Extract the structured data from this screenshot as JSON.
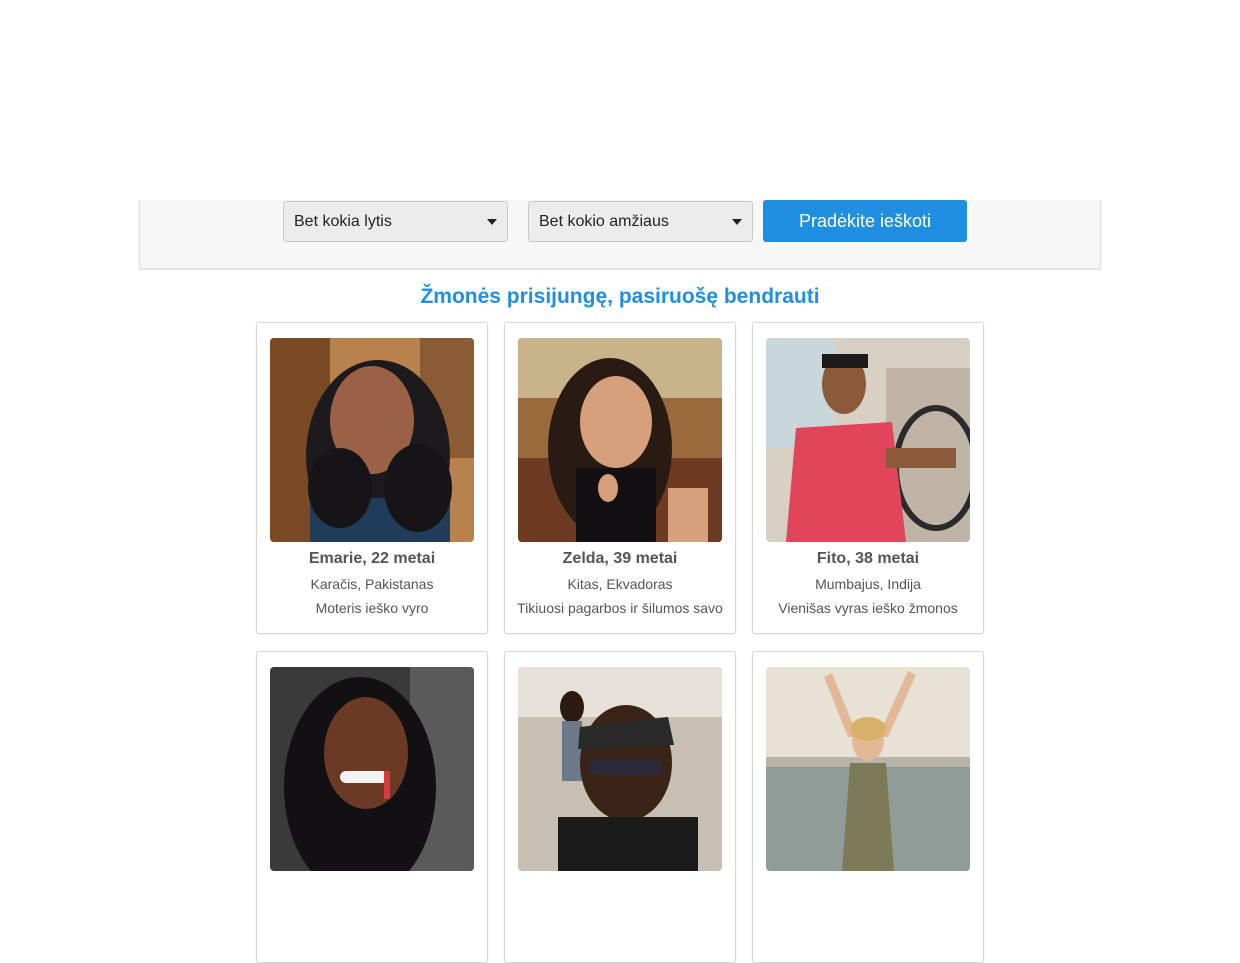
{
  "search": {
    "gender_value": "Bet kokia lytis",
    "age_value": "Bet kokio amžiaus",
    "submit_label": "Pradėkite ieškoti"
  },
  "section": {
    "title": "Žmonės prisijungę, pasiruošę bendrauti"
  },
  "profiles": [
    {
      "name": "Emarie, 22 metai",
      "location": "Karačis, Pakistanas",
      "bio": "Moteris ieško vyro"
    },
    {
      "name": "Zelda, 39 metai",
      "location": "Kitas, Ekvadoras",
      "bio": "Tikiuosi pagarbos ir šilumos savo"
    },
    {
      "name": "Fito, 38 metai",
      "location": "Mumbajus, Indija",
      "bio": "Vienišas vyras ieško žmonos"
    },
    {
      "name": "",
      "location": "",
      "bio": ""
    },
    {
      "name": "",
      "location": "",
      "bio": ""
    },
    {
      "name": "",
      "location": "",
      "bio": ""
    }
  ],
  "colors": {
    "accent": "#1e8fe1",
    "panel_bg": "#f7f7f7",
    "select_bg": "#ececec",
    "text": "#555555"
  },
  "icons": {
    "select_caret": "caret-down-icon"
  }
}
